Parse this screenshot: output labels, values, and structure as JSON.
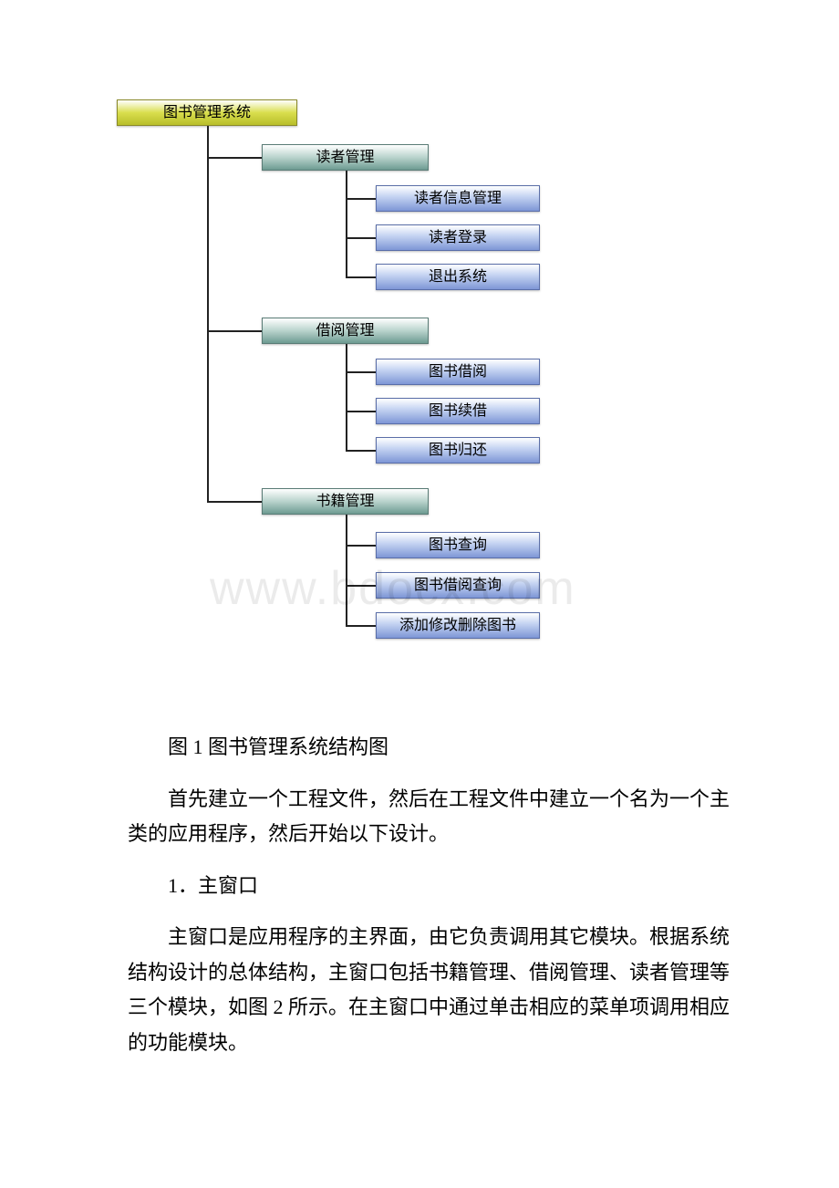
{
  "diagram": {
    "root": "图书管理系统",
    "watermark": "www.bdocx.com",
    "categories": [
      {
        "label": "读者管理",
        "items": [
          "读者信息管理",
          "读者登录",
          "退出系统"
        ]
      },
      {
        "label": "借阅管理",
        "items": [
          "图书借阅",
          "图书续借",
          "图书归还"
        ]
      },
      {
        "label": "书籍管理",
        "items": [
          "图书查询",
          "图书借阅查询",
          "添加修改删除图书"
        ]
      }
    ]
  },
  "text": {
    "caption": "图 1 图书管理系统结构图",
    "p1": "首先建立一个工程文件，然后在工程文件中建立一个名为一个主类的应用程序，然后开始以下设计。",
    "s1": "1．主窗口",
    "p2": "主窗口是应用程序的主界面，由它负责调用其它模块。根据系统结构设计的总体结构，主窗口包括书籍管理、借阅管理、读者管理等三个模块，如图 2 所示。在主窗口中通过单击相应的菜单项调用相应的功能模块。"
  }
}
